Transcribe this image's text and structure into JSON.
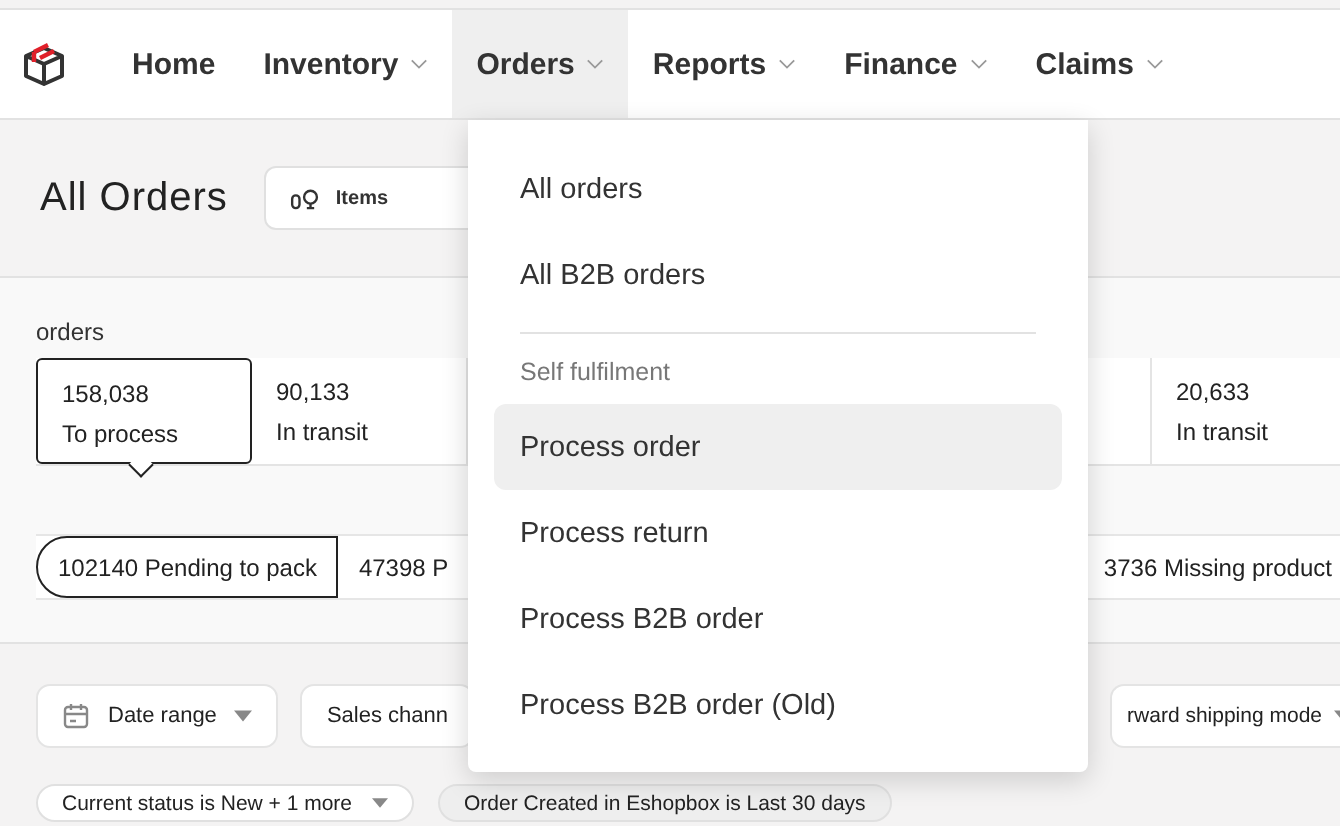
{
  "nav": {
    "items": [
      {
        "label": "Home",
        "has_menu": false,
        "selected": false
      },
      {
        "label": "Inventory",
        "has_menu": true,
        "selected": false
      },
      {
        "label": "Orders",
        "has_menu": true,
        "selected": true
      },
      {
        "label": "Reports",
        "has_menu": true,
        "selected": false
      },
      {
        "label": "Finance",
        "has_menu": true,
        "selected": false
      },
      {
        "label": "Claims",
        "has_menu": true,
        "selected": false
      }
    ]
  },
  "page": {
    "title": "All Orders",
    "view_selector": {
      "label": "Items"
    }
  },
  "stats": {
    "label": "orders",
    "cards": [
      {
        "value": "158,038",
        "label": "To process",
        "selected": true
      },
      {
        "value": "90,133",
        "label": "In transit",
        "selected": false
      },
      {
        "value": "20,633",
        "label": "In transit",
        "selected": false
      }
    ]
  },
  "status_chips": [
    {
      "label": "102140 Pending to pack",
      "selected": true
    },
    {
      "label": "47398 P",
      "selected": false
    },
    {
      "label": "3736 Missing product",
      "selected": false
    }
  ],
  "filters": [
    {
      "label": "Date range",
      "kind": "date"
    },
    {
      "label": "Sales chann",
      "kind": "plain"
    },
    {
      "label": "rward shipping mode",
      "kind": "dropdown"
    }
  ],
  "applied_filters": [
    {
      "label": "Current status is New + 1 more",
      "kind": "dropdown"
    },
    {
      "label": "Order Created in Eshopbox is Last 30 days",
      "kind": "plain"
    }
  ],
  "orders_menu": {
    "items": [
      {
        "kind": "item",
        "label": "All orders",
        "selected": false
      },
      {
        "kind": "item",
        "label": "All B2B orders",
        "selected": false
      },
      {
        "kind": "header",
        "label": "Self fulfilment"
      },
      {
        "kind": "item",
        "label": "Process order",
        "selected": true
      },
      {
        "kind": "item",
        "label": "Process return",
        "selected": false
      },
      {
        "kind": "item",
        "label": "Process B2B order",
        "selected": false
      },
      {
        "kind": "item",
        "label": "Process B2B order (Old)",
        "selected": false
      }
    ]
  }
}
